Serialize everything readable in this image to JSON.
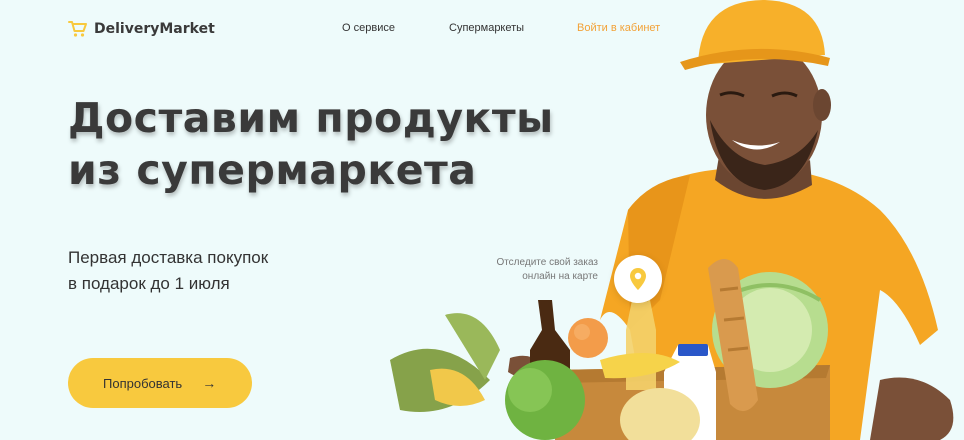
{
  "brand": {
    "name": "DeliveryMarket",
    "logo_icon": "cart-icon",
    "accent": "#f8c93e"
  },
  "nav": {
    "about": "О сервисе",
    "supermarkets": "Супермаркеты",
    "login": "Войти в кабинет",
    "login_color": "#f2a238"
  },
  "hero": {
    "title_line1": "Доставим продукты",
    "title_line2": "из супермаркета",
    "subtitle_line1": "Первая доставка покупок",
    "subtitle_line2": "в подарок до 1 июля",
    "cta_label": "Попробовать",
    "cta_icon": "arrow-right-icon"
  },
  "tracking": {
    "line1": "Отследите свой заказ",
    "line2": "онлайн на карте",
    "icon": "map-pin-icon"
  }
}
